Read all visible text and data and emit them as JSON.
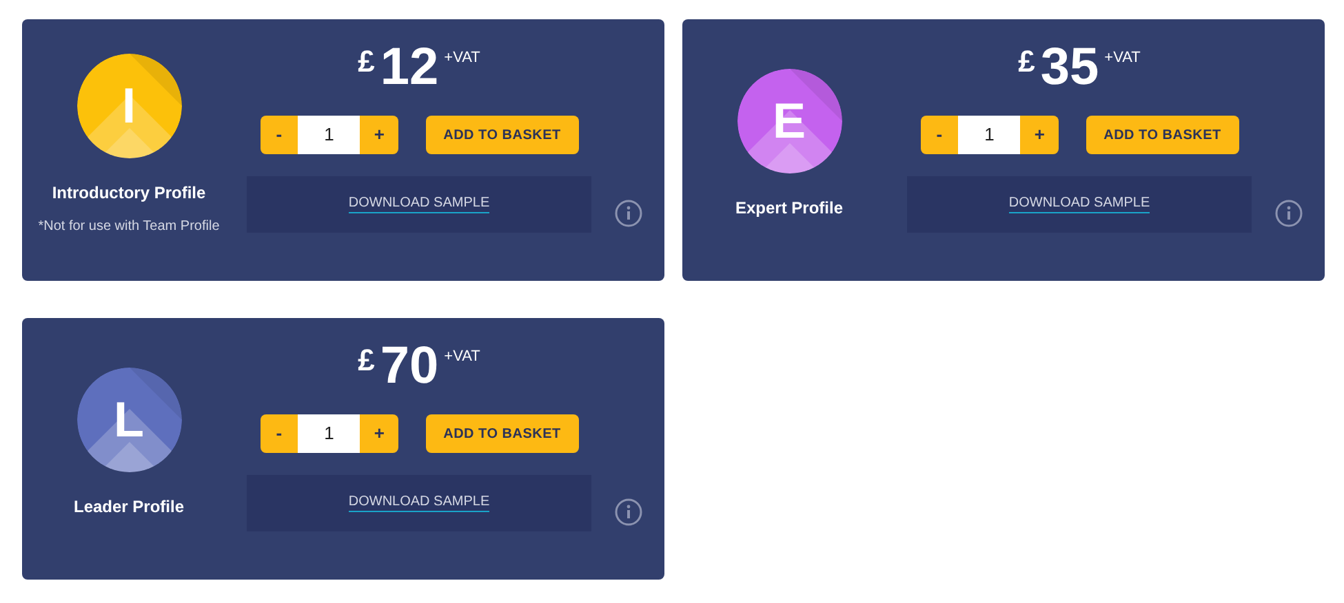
{
  "products": [
    {
      "initial": "I",
      "color": "#fcc10a",
      "name": "Introductory Profile",
      "note": "*Not for use with Team Profile",
      "currency": "£",
      "price": "12",
      "vat": "+VAT",
      "quantity": "1",
      "minus": "-",
      "plus": "+",
      "add_label": "ADD TO BASKET",
      "download_label": "DOWNLOAD SAMPLE"
    },
    {
      "initial": "E",
      "color": "#c462ee",
      "name": "Expert Profile",
      "currency": "£",
      "price": "35",
      "vat": "+VAT",
      "quantity": "1",
      "minus": "-",
      "plus": "+",
      "add_label": "ADD TO BASKET",
      "download_label": "DOWNLOAD SAMPLE"
    },
    {
      "initial": "L",
      "color": "#5e6fbd",
      "name": "Leader Profile",
      "currency": "£",
      "price": "70",
      "vat": "+VAT",
      "quantity": "1",
      "minus": "-",
      "plus": "+",
      "add_label": "ADD TO BASKET",
      "download_label": "DOWNLOAD SAMPLE"
    }
  ]
}
